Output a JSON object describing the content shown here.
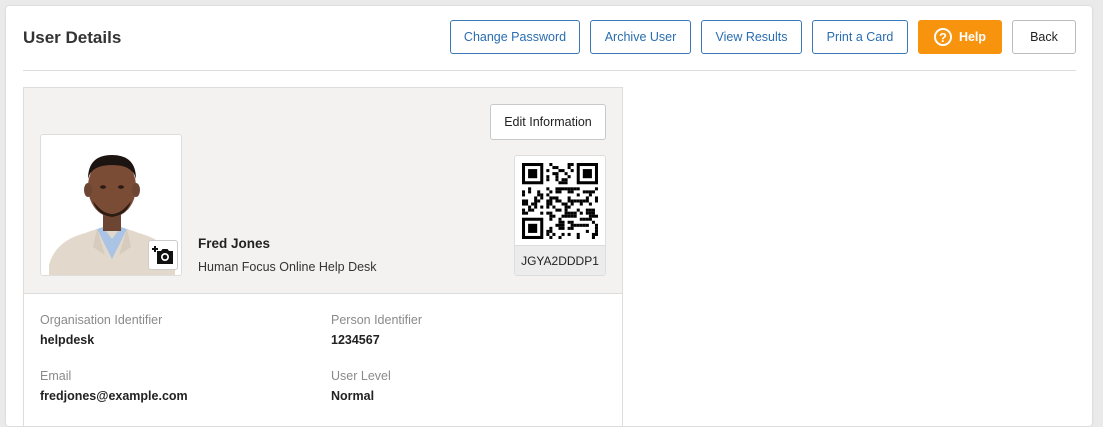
{
  "header": {
    "title": "User Details"
  },
  "toolbar": {
    "change_password": "Change Password",
    "archive_user": "Archive User",
    "view_results": "View Results",
    "print_card": "Print a Card",
    "help": "Help",
    "back": "Back"
  },
  "colors": {
    "accent": "#2a6db0",
    "help": "#f7930d"
  },
  "card": {
    "edit_label": "Edit Information",
    "name": "Fred Jones",
    "organisation": "Human Focus Online Help Desk",
    "qr_code": "JGYA2DDDP1",
    "fields": [
      {
        "label": "Organisation Identifier",
        "value": "helpdesk"
      },
      {
        "label": "Person Identifier",
        "value": "1234567"
      },
      {
        "label": "Email",
        "value": "fredjones@example.com"
      },
      {
        "label": "User Level",
        "value": "Normal"
      }
    ]
  }
}
